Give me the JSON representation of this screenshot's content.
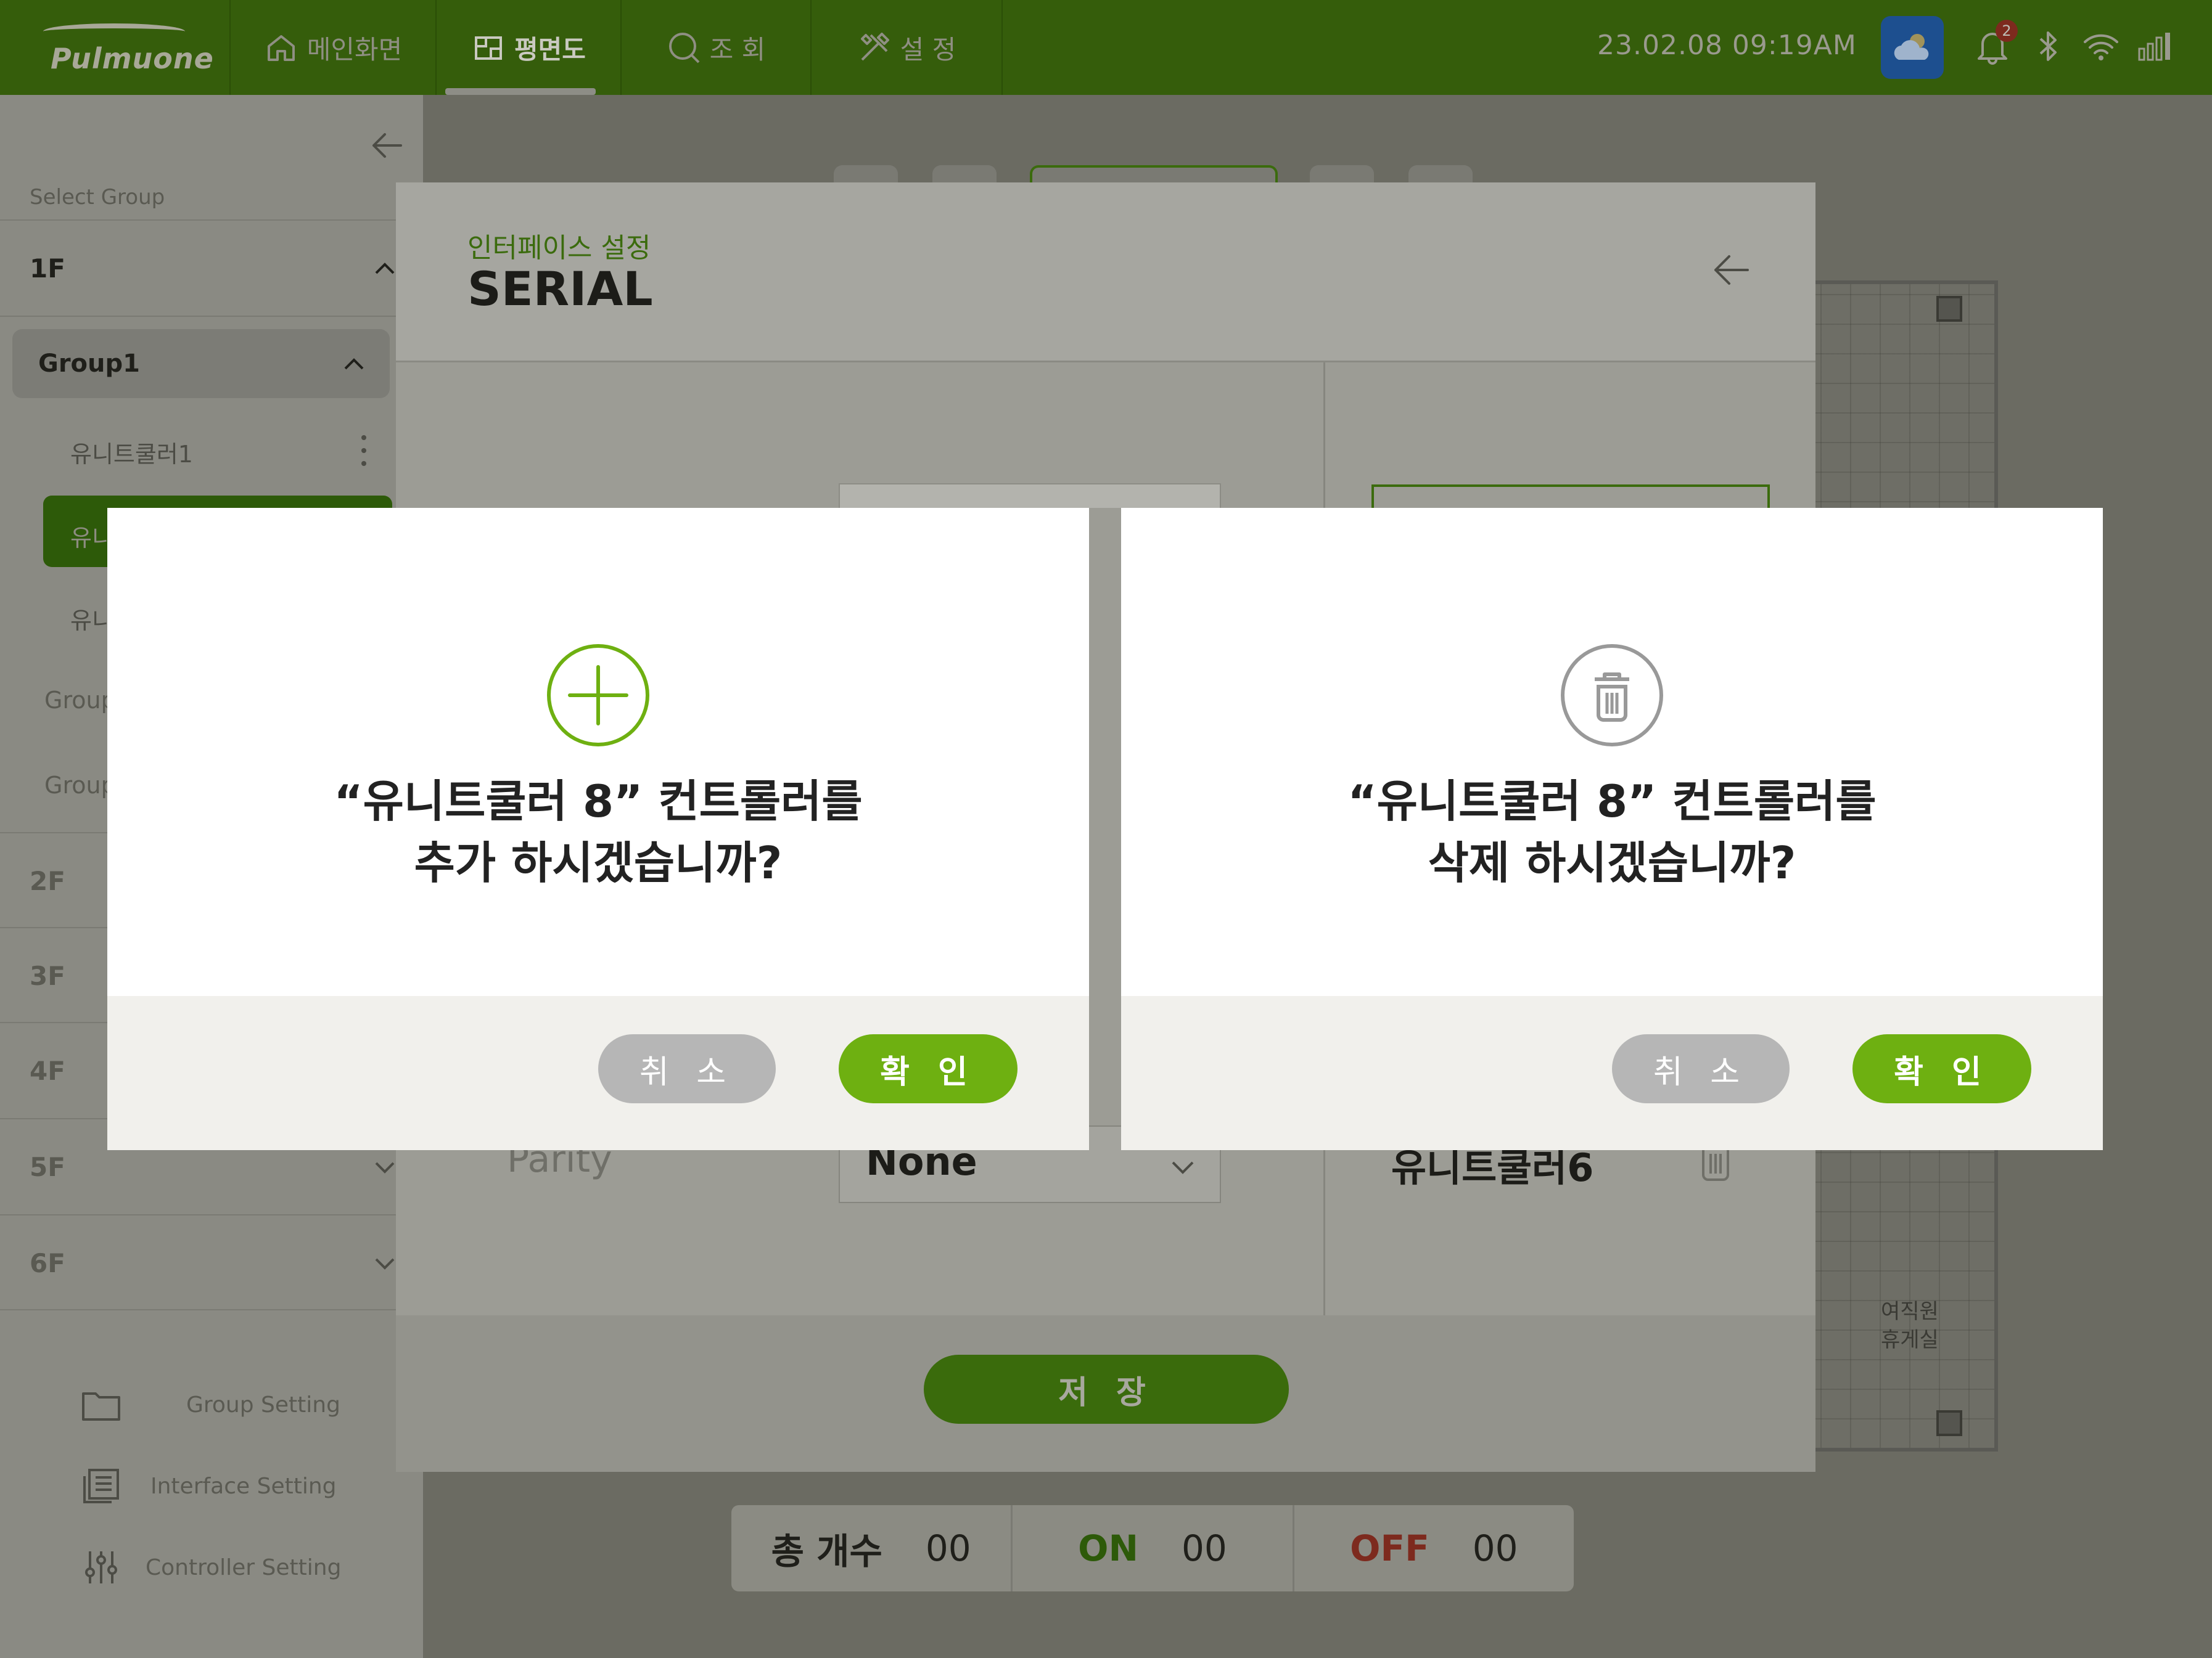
{
  "header": {
    "logo": "Pulmuone",
    "tabs": [
      {
        "label": "메인화면",
        "icon": "home-icon"
      },
      {
        "label": "평면도",
        "icon": "floorplan-icon",
        "active": true
      },
      {
        "label": "조 회",
        "icon": "search-icon"
      },
      {
        "label": "설 정",
        "icon": "tools-icon"
      }
    ],
    "datetime": "23.02.08  09:19AM",
    "notification_count": "2",
    "status_icons": [
      "weather-icon",
      "bell-icon",
      "bluetooth-icon",
      "wifi-icon",
      "signal-icon"
    ]
  },
  "sidebar": {
    "select_group_label": "Select Group",
    "floors": [
      "1F",
      "2F",
      "3F",
      "4F",
      "5F",
      "6F"
    ],
    "group1": "Group1",
    "units": [
      "유니트쿨러1",
      "유니",
      "유니"
    ],
    "other_groups": [
      "Group",
      "Group"
    ],
    "menu": [
      {
        "label": "Group Setting",
        "icon": "folder-icon"
      },
      {
        "label": "Interface Setting",
        "icon": "list-icon"
      },
      {
        "label": "Controller Setting",
        "icon": "sliders-icon"
      }
    ]
  },
  "panel": {
    "subtitle": "인터페이스 설정",
    "title": "SERIAL",
    "parity_label": "Parity",
    "parity_value": "None",
    "unit_item": "유니트쿨러6",
    "save_label": "저 장"
  },
  "map": {
    "room_label_1": "여직원",
    "room_label_2": "휴게실"
  },
  "stats": {
    "total_label": "총 개수",
    "total_value": "00",
    "on_label": "ON",
    "on_value": "00",
    "off_label": "OFF",
    "off_value": "00"
  },
  "dialogs": {
    "add": {
      "line1": "“유니트쿨러 8” 컨트롤러를",
      "line2": "추가 하시겠습니까?",
      "cancel": "취 소",
      "confirm": "확 인",
      "icon": "plus-circle-icon",
      "accent": "#6eb011"
    },
    "delete": {
      "line1": "“유니트쿨러 8” 컨트롤러를",
      "line2": "삭제 하시겠습니까?",
      "cancel": "취 소",
      "confirm": "확 인",
      "icon": "trash-circle-icon",
      "accent": "#999999"
    }
  },
  "colors": {
    "brand_green": "#6eb011",
    "topbar_dimmed": "#355d0b",
    "cancel_gray": "#b6b6b6",
    "dialog_footer": "#f1f0ec"
  }
}
